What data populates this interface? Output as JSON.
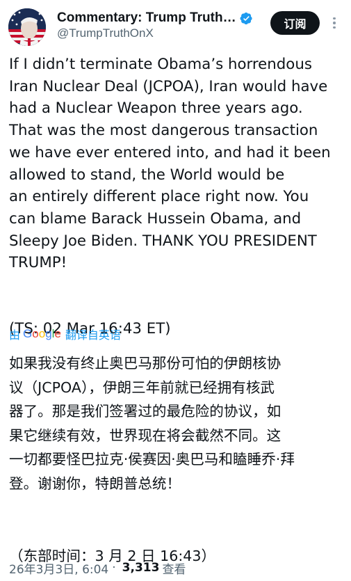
{
  "author": {
    "display_name": "Commentary: Trump Truth Social",
    "handle": "@TrumpTruthOnX",
    "verified_icon": "verified-badge-icon",
    "verified_color": "#1d9bf0"
  },
  "header": {
    "subscribe_label": "订阅",
    "more_icon": "more-vertical-icon"
  },
  "post": {
    "text": "If I didn’t terminate Obama’s horrendous\nIran Nuclear Deal (JCPOA), Iran would have\nhad a Nuclear Weapon three years ago.\nThat was the most dangerous transaction\nwe have ever entered into, and had it been\nallowed to stand, the World would be\nan entirely different place right now. You\ncan blame Barack Hussein Obama, and\nSleepy Joe Biden. THANK YOU PRESIDENT\nTRUMP!\n\n\n(TS: 02 Mar 16:43 ET)"
  },
  "translation": {
    "by_label": "由",
    "provider": "Google",
    "link_label": "翻译自英语",
    "text": "如果我没有终止奥巴马那份可怕的伊朗核协\n议（JCPOA），伊朗三年前就已经拥有核武\n器了。那是我们签署过的最危险的协议，如\n果它继续有效，世界现在将会截然不同。这\n一切都要怪巴拉克·侯赛因·奥巴马和瞌睡乔·拜\n登。谢谢你，特朗普总统！\n\n\n（东部时间：3 月 2 日 16:43）"
  },
  "meta": {
    "timestamp": "26年3月3日, 6:04",
    "separator": "·",
    "views_count": "3,313",
    "views_label": "查看"
  },
  "colors": {
    "accent": "#1d9bf0",
    "text_primary": "#0f1419",
    "text_secondary": "#536471"
  }
}
